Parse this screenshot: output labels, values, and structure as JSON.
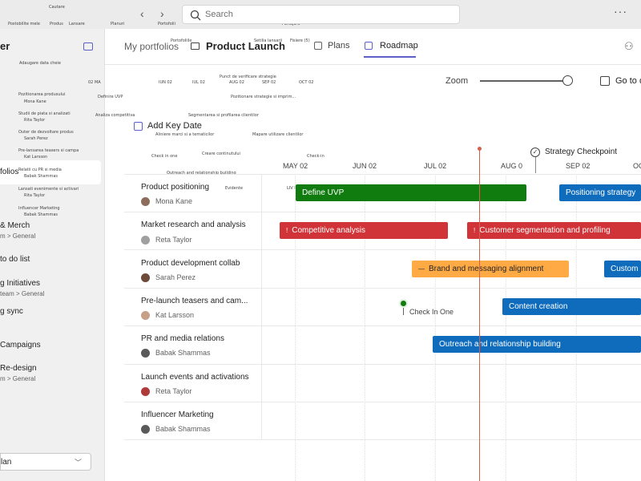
{
  "topbar": {
    "tiny_labels": [
      "Cautare",
      "Postobilite mele",
      "Produs",
      "Lansare",
      "Planuri",
      "Portofolii",
      "Partajare"
    ],
    "search_placeholder": "Search",
    "more": "···"
  },
  "sidebar": {
    "title": "er",
    "tiny_labels": [
      "Adaugare data cheie",
      "Pozitionarea produsului",
      "Mona Kane",
      "Studii de piata si analizati",
      "Rita Taylor",
      "Outer de dezvoltare produs",
      "Sarah Perez",
      "Pre-lansarea teasers si campa",
      "Kat Larsson",
      "Relatii cu PR si media",
      "Babak Shammas",
      "Lansati evenimente si activari",
      "Rita Taylor",
      "Influencer Marketing",
      "Babak Shammas"
    ],
    "selected_label": "folios",
    "items": [
      {
        "label": "& Merch",
        "sub": "m > General"
      },
      {
        "label": "to do list",
        "sub": ""
      },
      {
        "label": "g Initiatives",
        "sub": "team > General"
      },
      {
        "label": "g sync",
        "sub": ""
      },
      {
        "label": "Campaigns",
        "sub": ""
      },
      {
        "label": "Re-design",
        "sub": "m > General"
      }
    ],
    "dropdown_value": "lan"
  },
  "header": {
    "breadcrumb": "My portfolios",
    "tiny_breadcrumb": "Portofoliile",
    "title": "Product Launch",
    "tiny_title": "Setilia lansarii",
    "tiny_files": "Fisiere (5)",
    "tabs": [
      {
        "label": "Plans",
        "active": false
      },
      {
        "label": "Roadmap",
        "active": true
      }
    ]
  },
  "toolbar": {
    "zoom_label": "Zoom",
    "zoom_level": 1.0,
    "goto_label": "Go to d",
    "add_key_date": "Add Key Date"
  },
  "timeline": {
    "months": [
      "MAY 02",
      "JUN 02",
      "JUL 02",
      "AUG 0",
      "SEP 02",
      "OC"
    ],
    "checkpoint": "Strategy Checkpoint",
    "tiny_months": [
      "02 MA",
      "IUN 02",
      "IUL 02",
      "AUG 02",
      "SEP 02",
      "OCT 02"
    ],
    "tiny_overlays": [
      "Punct de verificare strategie",
      "Definire UVP",
      "Pozitionare strategie si imprim...",
      "Analiza competitiva",
      "Segmentarea si profilarea clientilor",
      "Aliniere marci si a tematicilor",
      "Mapare utilizare clientilor",
      "Check in one",
      "Creare continutului",
      "Outreach and relationship building",
      "Check-in",
      "LIV Lansare",
      "Evidente"
    ]
  },
  "rows": [
    {
      "label": "Product positioning",
      "owner": "Mona Kane"
    },
    {
      "label": "Market research and analysis",
      "owner": "Reta Taylor"
    },
    {
      "label": "Product development collab",
      "owner": "Sarah Perez"
    },
    {
      "label": "Pre-launch teasers and cam...",
      "owner": "Kat Larsson"
    },
    {
      "label": "PR and media relations",
      "owner": "Babak Shammas"
    },
    {
      "label": "Launch events and activations",
      "owner": "Reta Taylor"
    },
    {
      "label": "Influencer Marketing",
      "owner": "Babak Shammas"
    }
  ],
  "bars": [
    {
      "label": "Define UVP",
      "color": "#107c10",
      "row": 0
    },
    {
      "label": "Positioning strategy",
      "color": "#0f6cbd",
      "row": 0
    },
    {
      "label": "Competitive analysis",
      "color": "#d13438",
      "row": 1
    },
    {
      "label": "Customer segmentation and profiling",
      "color": "#d13438",
      "row": 1
    },
    {
      "label": "Brand and messaging alignment",
      "color": "#ffaa44",
      "row": 2
    },
    {
      "label": "Custom",
      "color": "#0f6cbd",
      "row": 2
    },
    {
      "label": "Content creation",
      "color": "#0f6cbd",
      "row": 3
    },
    {
      "label": "Outreach and relationship building",
      "color": "#0f6cbd",
      "row": 4
    }
  ],
  "milestone": {
    "label": "Check In One",
    "row": 3
  },
  "bar_icons": {
    "red": "!",
    "orange": "—"
  }
}
